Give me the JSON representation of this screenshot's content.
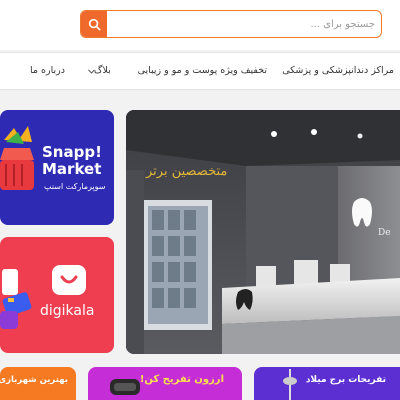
{
  "search": {
    "placeholder": "جستجو برای ..."
  },
  "nav": {
    "items": [
      "مراکز دندانپزشکی و پزشکی",
      "تخفیف ویژه پوست و مو و زیبایی",
      "بلاگ",
      "درباره ما"
    ]
  },
  "banners": {
    "snapp": {
      "title_line1": "Snapp!",
      "title_line2": "Market",
      "subtitle": "سوپرمارکت اسنپ"
    },
    "digikala": {
      "title": "digikala"
    },
    "hero": {
      "caption": "متخصصین برتر",
      "sign_text": "De"
    },
    "bottom": [
      {
        "label": "بهترین شهربازی ه"
      },
      {
        "label": "ارزون تفریح کن!"
      },
      {
        "label": "تفریحات برج میلاد"
      }
    ]
  },
  "colors": {
    "accent": "#f0692c",
    "snapp_bg": "#2f2ab4",
    "digikala_bg": "#ee3e50"
  },
  "icons": {
    "search": "search-icon",
    "nav_dropdown": "chevron-down-icon"
  }
}
